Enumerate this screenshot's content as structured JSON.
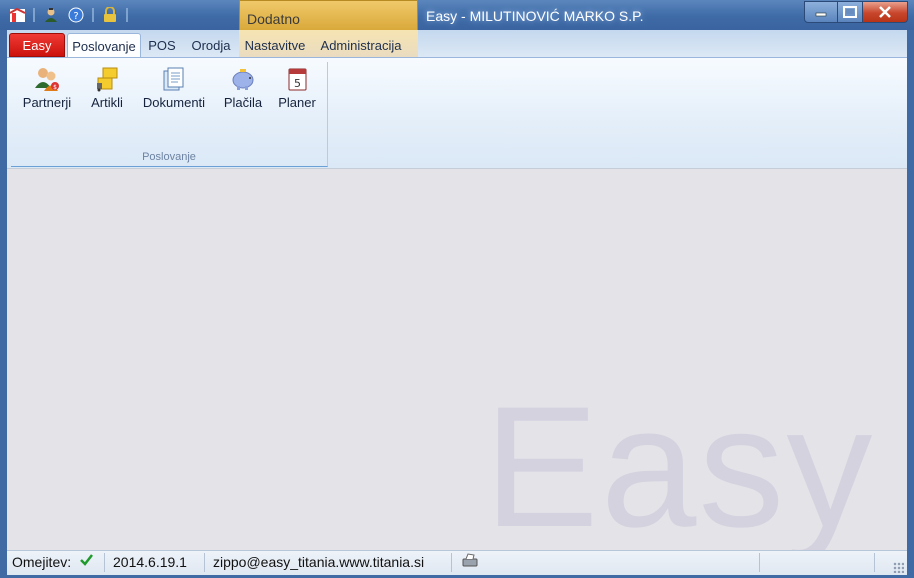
{
  "window": {
    "title": "Easy - MILUTINOVIĆ MARKO S.P.",
    "context_group": "Dodatno",
    "controls": [
      "minimize-icon",
      "maximize-icon",
      "close-icon"
    ]
  },
  "quick_access": [
    "app-icon",
    "user-icon",
    "help-icon",
    "lock-icon"
  ],
  "tabs": {
    "app": "Easy",
    "items": [
      {
        "label": "Poslovanje",
        "active": true
      },
      {
        "label": "POS"
      },
      {
        "label": "Orodja"
      },
      {
        "label": "Nastavitve"
      },
      {
        "label": "Administracija"
      }
    ]
  },
  "ribbon": {
    "group_title": "Poslovanje",
    "buttons": [
      {
        "label": "Partnerji",
        "icon": "partners-icon"
      },
      {
        "label": "Artikli",
        "icon": "articles-icon"
      },
      {
        "label": "Dokumenti",
        "icon": "documents-icon"
      },
      {
        "label": "Plačila",
        "icon": "piggy-bank-icon"
      },
      {
        "label": "Planer",
        "icon": "calendar-icon"
      }
    ]
  },
  "content": {
    "watermark": "Easy"
  },
  "status": {
    "restriction_label": "Omejitev:",
    "version": "2014.6.19.1",
    "connection": "zippo@easy_titania.www.titania.si"
  },
  "colors": {
    "accent": "#3f6aa3",
    "app_tab": "#e0201a",
    "context": "#e3b64c"
  }
}
